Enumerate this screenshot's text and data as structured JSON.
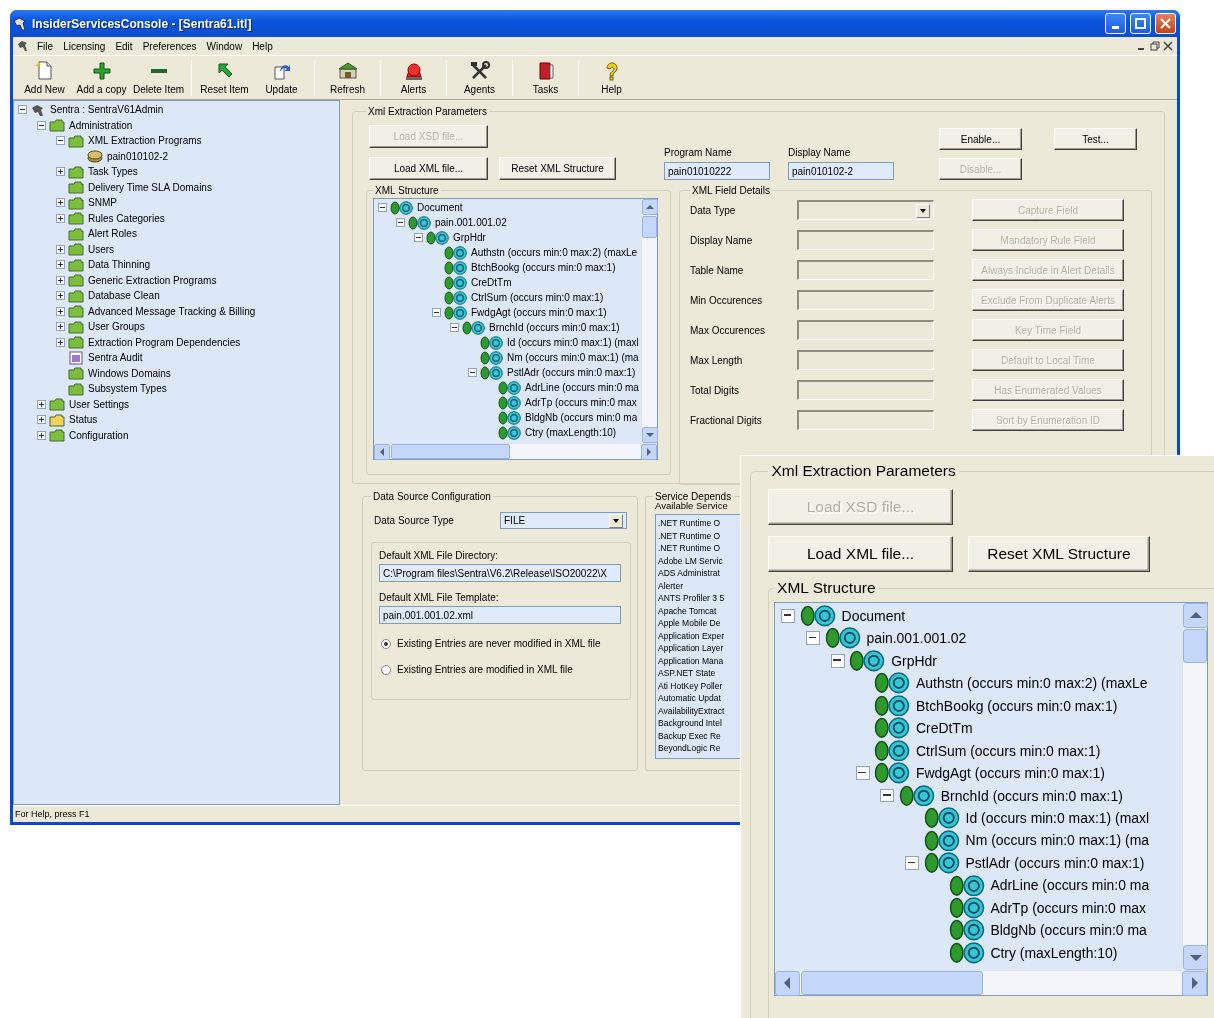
{
  "window": {
    "title": "InsiderServicesConsole - [Sentra61.itl]"
  },
  "menu": [
    "File",
    "Licensing",
    "Edit",
    "Preferences",
    "Window",
    "Help"
  ],
  "toolbar": [
    {
      "label": "Add New",
      "kind": "new",
      "separator_before": false
    },
    {
      "label": "Add a copy",
      "kind": "add",
      "separator_before": false
    },
    {
      "label": "Delete Item",
      "kind": "delete",
      "separator_before": false
    },
    {
      "label": "Reset Item",
      "kind": "reset",
      "separator_before": true
    },
    {
      "label": "Update",
      "kind": "update",
      "separator_before": false
    },
    {
      "label": "Refresh",
      "kind": "refresh",
      "separator_before": true
    },
    {
      "label": "Alerts",
      "kind": "alerts",
      "separator_before": true
    },
    {
      "label": "Agents",
      "kind": "agents",
      "separator_before": true
    },
    {
      "label": "Tasks",
      "kind": "tasks",
      "separator_before": true
    },
    {
      "label": "Help",
      "kind": "help",
      "separator_before": true
    }
  ],
  "nav_tree": [
    {
      "label": "Sentra : SentraV61Admin",
      "kind": "root",
      "expanded": true,
      "children": [
        {
          "label": "Administration",
          "kind": "folder",
          "color": "#7cbf3c",
          "expanded": true,
          "children": [
            {
              "label": "XML Extraction Programs",
              "kind": "folder",
              "color": "#7cbf3c",
              "expanded": true,
              "children": [
                {
                  "label": "pain010102-2",
                  "kind": "drive"
                }
              ]
            },
            {
              "label": "Task Types",
              "kind": "folder",
              "color": "#7cbf3c",
              "expanded": false
            },
            {
              "label": "Delivery Time SLA Domains",
              "kind": "folder",
              "color": "#7cbf3c"
            },
            {
              "label": "SNMP",
              "kind": "folder",
              "color": "#7cbf3c",
              "expanded": false
            },
            {
              "label": "Rules Categories",
              "kind": "folder",
              "color": "#7cbf3c",
              "expanded": false
            },
            {
              "label": "Alert Roles",
              "kind": "folder",
              "color": "#7cbf3c"
            },
            {
              "label": "Users",
              "kind": "folder",
              "color": "#7cbf3c",
              "expanded": false
            },
            {
              "label": "Data Thinning",
              "kind": "folder",
              "color": "#7cbf3c",
              "expanded": false
            },
            {
              "label": "Generic Extraction Programs",
              "kind": "folder",
              "color": "#7cbf3c",
              "expanded": false
            },
            {
              "label": "Database Clean",
              "kind": "folder",
              "color": "#7cbf3c",
              "expanded": false
            },
            {
              "label": "Advanced Message Tracking & Billing",
              "kind": "folder",
              "color": "#7cbf3c",
              "expanded": false
            },
            {
              "label": "User Groups",
              "kind": "folder",
              "color": "#7cbf3c",
              "expanded": false
            },
            {
              "label": "Extraction Program Dependencies",
              "kind": "folder",
              "color": "#7cbf3c",
              "expanded": false
            },
            {
              "label": "Sentra Audit",
              "kind": "document"
            },
            {
              "label": "Windows Domains",
              "kind": "folder",
              "color": "#7cbf3c"
            },
            {
              "label": "Subsystem Types",
              "kind": "folder",
              "color": "#7cbf3c"
            }
          ]
        },
        {
          "label": "User Settings",
          "kind": "folder",
          "color": "#7cbf3c",
          "expanded": false
        },
        {
          "label": "Status",
          "kind": "folder",
          "color": "#f2d35a",
          "expanded": false
        },
        {
          "label": "Configuration",
          "kind": "folder",
          "color": "#7cbf3c",
          "expanded": false
        }
      ]
    }
  ],
  "extraction": {
    "title": "Xml Extraction Parameters",
    "buttons": [
      {
        "label": "Load XSD file...",
        "disabled": true
      },
      {
        "label": "Load XML file...",
        "disabled": false
      },
      {
        "label": "Reset XML Structure",
        "disabled": false
      }
    ],
    "program_name": {
      "label": "Program Name",
      "value": "pain01010222"
    },
    "display_name": {
      "label": "Display Name",
      "value": "pain010102-2"
    },
    "actions": [
      {
        "label": "Enable...",
        "disabled": false
      },
      {
        "label": "Test...",
        "disabled": false
      },
      {
        "label": "Disable...",
        "disabled": true
      }
    ],
    "structure_title": "XML Structure",
    "nodes": [
      {
        "label": "Document",
        "expanded": true,
        "children": [
          {
            "label": "pain.001.001.02",
            "expanded": true,
            "children": [
              {
                "label": "GrpHdr",
                "expanded": true,
                "children": [
                  {
                    "label": "Authstn (occurs min:0 max:2) (maxLe"
                  },
                  {
                    "label": "BtchBookg (occurs min:0 max:1)"
                  },
                  {
                    "label": "CreDtTm"
                  },
                  {
                    "label": "CtrlSum (occurs min:0 max:1)"
                  },
                  {
                    "label": "FwdgAgt (occurs min:0 max:1)",
                    "expanded": true,
                    "children": [
                      {
                        "label": "BrnchId (occurs min:0 max:1)",
                        "expanded": true,
                        "children": [
                          {
                            "label": "Id (occurs min:0 max:1) (maxl"
                          },
                          {
                            "label": "Nm (occurs min:0 max:1) (ma"
                          },
                          {
                            "label": "PstlAdr (occurs min:0 max:1)",
                            "expanded": true,
                            "children": [
                              {
                                "label": "AdrLine (occurs min:0 ma"
                              },
                              {
                                "label": "AdrTp (occurs min:0 max"
                              },
                              {
                                "label": "BldgNb (occurs min:0 ma"
                              },
                              {
                                "label": "Ctry (maxLength:10)"
                              }
                            ]
                          }
                        ]
                      }
                    ]
                  }
                ]
              }
            ]
          }
        ]
      }
    ]
  },
  "field_details": {
    "title": "XML Field Details",
    "rows": [
      {
        "label": "Data Type",
        "kind": "dropdown",
        "disabled": true
      },
      {
        "label": "Display Name",
        "kind": "text",
        "disabled": true
      },
      {
        "label": "Table Name",
        "kind": "text",
        "disabled": true
      },
      {
        "label": "Min Occurences",
        "kind": "text",
        "disabled": true
      },
      {
        "label": "Max Occurences",
        "kind": "text",
        "disabled": true
      },
      {
        "label": "Max Length",
        "kind": "text",
        "disabled": true
      },
      {
        "label": "Total Digits",
        "kind": "text",
        "disabled": true
      },
      {
        "label": "Fractional Digits",
        "kind": "text",
        "disabled": true
      }
    ],
    "buttons": [
      {
        "label": "Capture Field",
        "disabled": true
      },
      {
        "label": "Mandatory Rule Field",
        "disabled": true
      },
      {
        "label": "Always Include in Alert Details",
        "disabled": true
      },
      {
        "label": "Exclude From Duplicate Alerts",
        "disabled": true
      },
      {
        "label": "Key Time Field",
        "disabled": true
      },
      {
        "label": "Default to Local Time",
        "disabled": true
      },
      {
        "label": "Has Enumerated Values",
        "disabled": true
      },
      {
        "label": "Sort by Enumeration ID",
        "disabled": true
      }
    ]
  },
  "data_source": {
    "title": "Data Source Configuration",
    "type_label": "Data Source Type",
    "type_value": "FILE",
    "directory_label": "Default XML File Directory:",
    "directory_value": "C:\\Program files\\Sentra\\V6.2\\Release\\ISO20022\\X",
    "template_label": "Default XML File Template:",
    "template_value": "pain.001.001.02.xml",
    "options": [
      {
        "label": "Existing Entries are never modified in XML file",
        "selected": true
      },
      {
        "label": "Existing Entries are modified in XML file",
        "selected": false
      }
    ]
  },
  "service_dependencies": {
    "title": "Service Depends",
    "list_label": "Available Service",
    "items": [
      ".NET Runtime O",
      ".NET Runtime O",
      ".NET Runtime O",
      "Adobe LM Servic",
      "ADS Administrat",
      "Alerter",
      "ANTS Profiler 3 5",
      "Apache Tomcat",
      "Apple Mobile De",
      "Application Exper",
      "Application Layer",
      "Application Mana",
      "ASP.NET State",
      "Ati HotKey Poller",
      "Automatic Updat",
      "AvailabilityExtract",
      "Background Intel",
      "Backup Exec Re",
      "BeyondLogic Re"
    ]
  },
  "status_bar": "For Help, press F1",
  "inset": {
    "title": "Xml Extraction Parameters",
    "buttons": [
      {
        "label": "Load XSD file...",
        "disabled": true
      },
      {
        "label": "Load XML file...",
        "disabled": false
      },
      {
        "label": "Reset XML Structure",
        "disabled": false
      }
    ],
    "structure_title": "XML Structure",
    "nodes": [
      {
        "label": "Document",
        "expanded": true,
        "children": [
          {
            "label": "pain.001.001.02",
            "expanded": true,
            "children": [
              {
                "label": "GrpHdr",
                "expanded": true,
                "children": [
                  {
                    "label": "Authstn (occurs min:0 max:2) (maxLe"
                  },
                  {
                    "label": "BtchBookg (occurs min:0 max:1)"
                  },
                  {
                    "label": "CreDtTm"
                  },
                  {
                    "label": "CtrlSum (occurs min:0 max:1)"
                  },
                  {
                    "label": "FwdgAgt (occurs min:0 max:1)",
                    "expanded": true,
                    "children": [
                      {
                        "label": "BrnchId (occurs min:0 max:1)",
                        "expanded": true,
                        "children": [
                          {
                            "label": "Id (occurs min:0 max:1) (maxl"
                          },
                          {
                            "label": "Nm (occurs min:0 max:1) (ma"
                          },
                          {
                            "label": "PstlAdr (occurs min:0 max:1)",
                            "expanded": true,
                            "children": [
                              {
                                "label": "AdrLine (occurs min:0 ma"
                              },
                              {
                                "label": "AdrTp (occurs min:0 max"
                              },
                              {
                                "label": "BldgNb (occurs min:0 ma"
                              },
                              {
                                "label": "Ctry (maxLength:10)"
                              }
                            ]
                          }
                        ]
                      }
                    ]
                  }
                ]
              }
            ]
          }
        ]
      }
    ]
  }
}
